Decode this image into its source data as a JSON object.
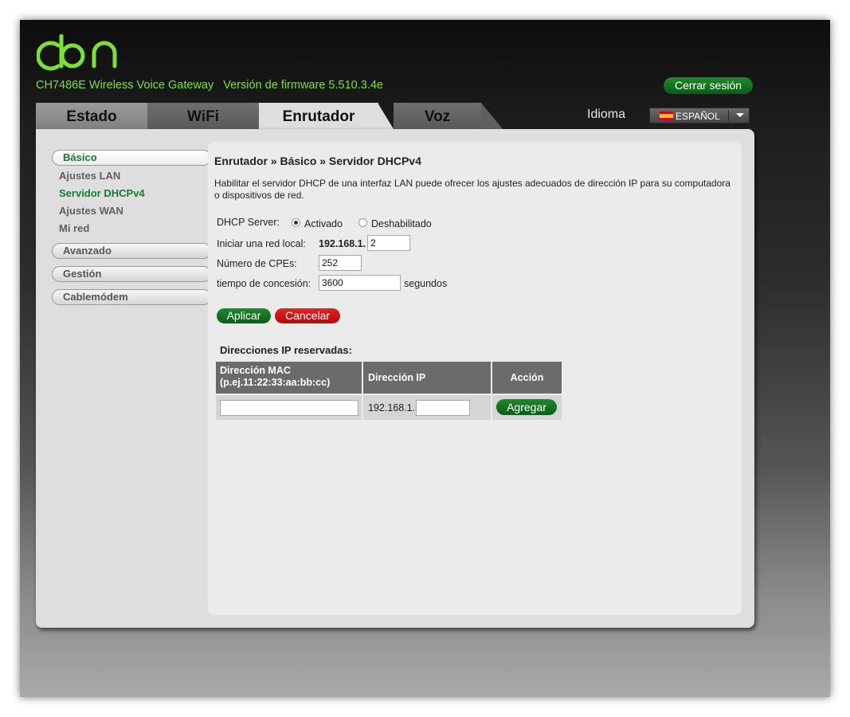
{
  "header": {
    "model": "CH7486E Wireless Voice Gateway",
    "firmware": "Versión de firmware 5.510.3.4e",
    "logout_label": "Cerrar sesión",
    "language_label": "Idioma",
    "language_value": "ESPAÑOL",
    "brand_color": "#7ee033"
  },
  "tabs": [
    {
      "label": "Estado"
    },
    {
      "label": "WiFi"
    },
    {
      "label": "Enrutador",
      "active": true
    },
    {
      "label": "Voz"
    }
  ],
  "sidebar": {
    "groups": [
      {
        "label": "Básico",
        "items": [
          "Ajustes LAN",
          "Servidor DHCPv4",
          "Ajustes WAN",
          "Mi red"
        ],
        "active_item": "Servidor DHCPv4"
      },
      {
        "label": "Avanzado"
      },
      {
        "label": "Gestión"
      },
      {
        "label": "Cablemódem"
      }
    ]
  },
  "content": {
    "breadcrumb": "Enrutador » Básico » Servidor DHCPv4",
    "description": "Habilitar el servidor DHCP de una interfaz LAN puede ofrecer los ajustes adecuados de dirección IP para su computadora o dispositivos de red.",
    "dhcp_label": "DHCP Server:",
    "radio_on": "Activado",
    "radio_off": "Deshabilitado",
    "dhcp_enabled": true,
    "start_label": "Iniciar una red local:",
    "start_prefix": "192.168.1.",
    "start_value": "2",
    "cpe_label": "Número de CPEs:",
    "cpe_value": "252",
    "lease_label": "tiempo de concesión:",
    "lease_value": "3600",
    "lease_unit": "segundos",
    "apply_label": "Aplicar",
    "cancel_label": "Cancelar"
  },
  "reserved": {
    "title": "Direcciones IP reservadas:",
    "col_mac": "Dirección MAC",
    "col_mac_hint": "(p.ej.11:22:33:aa:bb:cc)",
    "col_ip": "Dirección IP",
    "col_action": "Acción",
    "ip_prefix": "192.168.1.",
    "mac_value": "",
    "ip_value": "",
    "add_label": "Agregar"
  }
}
